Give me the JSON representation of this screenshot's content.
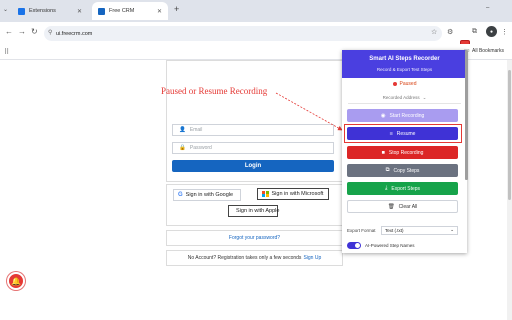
{
  "tabs": [
    {
      "label": "Extensions",
      "favicon_color": "#1a73e8",
      "active": false
    },
    {
      "label": "Free CRM",
      "favicon_color": "#1565c0",
      "active": true
    }
  ],
  "tab_search_icon": "chevron-down",
  "new_tab_label": "+",
  "window_controls": [
    "–",
    "□",
    "✕"
  ],
  "address_bar": {
    "url": "ui.freecrm.com"
  },
  "bookmarks": {
    "all_bookmarks": "All Bookmarks"
  },
  "login": {
    "email_placeholder": "Email",
    "password_placeholder": "Password",
    "login_label": "Login"
  },
  "social": {
    "google_label": "Sign in with Google",
    "microsoft_label": "Sign in with Microsoft",
    "apple_label": "Sign in with Apple"
  },
  "forgot_password": "Forgot your password?",
  "signup": {
    "text": "No Account? Registration takes only a few seconds",
    "link": "Sign Up"
  },
  "annotation": {
    "text": "Paused or Resume Recording",
    "color": "#e53935"
  },
  "popup": {
    "title": "Smart AI Steps Recorder",
    "subtitle": "Record & Export Test Steps",
    "status": "Paused",
    "recorded_address_label": "Recorded Address",
    "buttons": {
      "start": "Start Recording",
      "resume": "Resume",
      "stop": "Stop Recording",
      "copy": "Copy Steps",
      "export": "Export Steps",
      "clear": "Clear All"
    },
    "export_format_label": "Export Format",
    "export_format_value": "Text (.txt)",
    "toggle_label": "AI-Powered Step Names",
    "accent_color": "#4a3fe0"
  }
}
